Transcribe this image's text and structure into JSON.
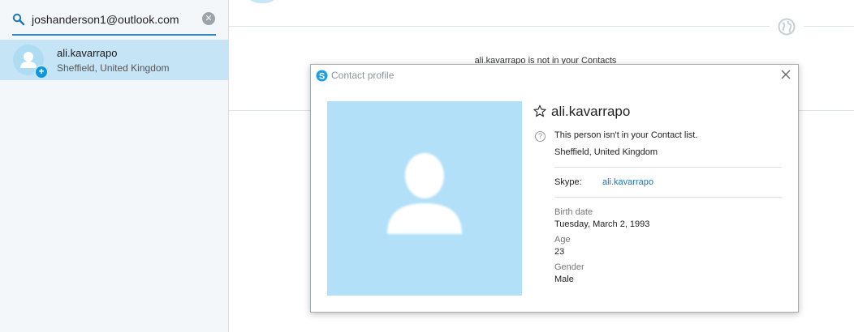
{
  "search": {
    "value": "joshanderson1@outlook.com",
    "clear_glyph": "✕"
  },
  "result": {
    "name": "ali.kavarrapo",
    "location": "Sheffield, United Kingdom",
    "badge_glyph": "+"
  },
  "main": {
    "notice": "ali.kavarrapo is not in your Contacts"
  },
  "dialog": {
    "title": "Contact profile",
    "name": "ali.kavarrapo",
    "not_in_contacts": "This person isn't in your Contact list.",
    "location": "Sheffield, United Kingdom",
    "skype_label": "Skype:",
    "skype_value": "ali.kavarrapo",
    "birth_label": "Birth date",
    "birth_value": "Tuesday, March 2, 1993",
    "age_label": "Age",
    "age_value": "23",
    "gender_label": "Gender",
    "gender_value": "Male",
    "help_glyph": "?"
  },
  "colors": {
    "accent": "#0f97d9",
    "selected_row": "#c5e5f7",
    "photo_bg": "#b1e0f8"
  },
  "icons": [
    "search-icon",
    "clear-search-icon",
    "add-contact-icon",
    "globe-icon",
    "skype-logo-icon",
    "close-icon",
    "favorite-star-icon",
    "help-icon",
    "default-avatar-icon"
  ]
}
